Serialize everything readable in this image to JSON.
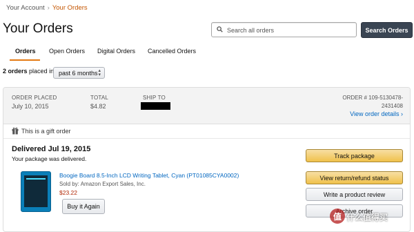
{
  "breadcrumb": {
    "account": "Your Account",
    "separator": "›",
    "current": "Your Orders"
  },
  "page": {
    "title": "Your Orders"
  },
  "search": {
    "placeholder": "Search all orders",
    "button_label": "Search Orders"
  },
  "tabs": [
    {
      "label": "Orders",
      "active": true
    },
    {
      "label": "Open Orders",
      "active": false
    },
    {
      "label": "Digital Orders",
      "active": false
    },
    {
      "label": "Cancelled Orders",
      "active": false
    }
  ],
  "filter": {
    "count_text": "2 orders",
    "placed_in_text": "placed in",
    "period": "past 6 months"
  },
  "order": {
    "placed_label": "ORDER PLACED",
    "placed_value": "July 10, 2015",
    "total_label": "TOTAL",
    "total_value": "$4.82",
    "ship_to_label": "SHIP TO",
    "order_number_label": "ORDER # 109-5130478-",
    "order_number_cont": "2431408",
    "details_link": "View order details ›",
    "gift_text": "This is a gift order",
    "status_title": "Delivered Jul 19, 2015",
    "status_sub": "Your package was delivered.",
    "product": {
      "title": "Boogie Board 8.5-Inch LCD Writing Tablet, Cyan (PT01085CYA0002)",
      "seller": "Sold by: Amazon Export Sales, Inc.",
      "price": "$23.22",
      "buy_again_label": "Buy it Again"
    },
    "actions": {
      "track": "Track package",
      "return": "View return/refund status",
      "review": "Write a product review",
      "archive": "Archive order"
    }
  },
  "watermark": {
    "badge": "值",
    "text": "什么值得买"
  },
  "colors": {
    "accent": "#e47911",
    "link": "#0066c0",
    "price": "#b12704",
    "search_button": "#3a4553",
    "primary_button": "#f0c14b"
  }
}
